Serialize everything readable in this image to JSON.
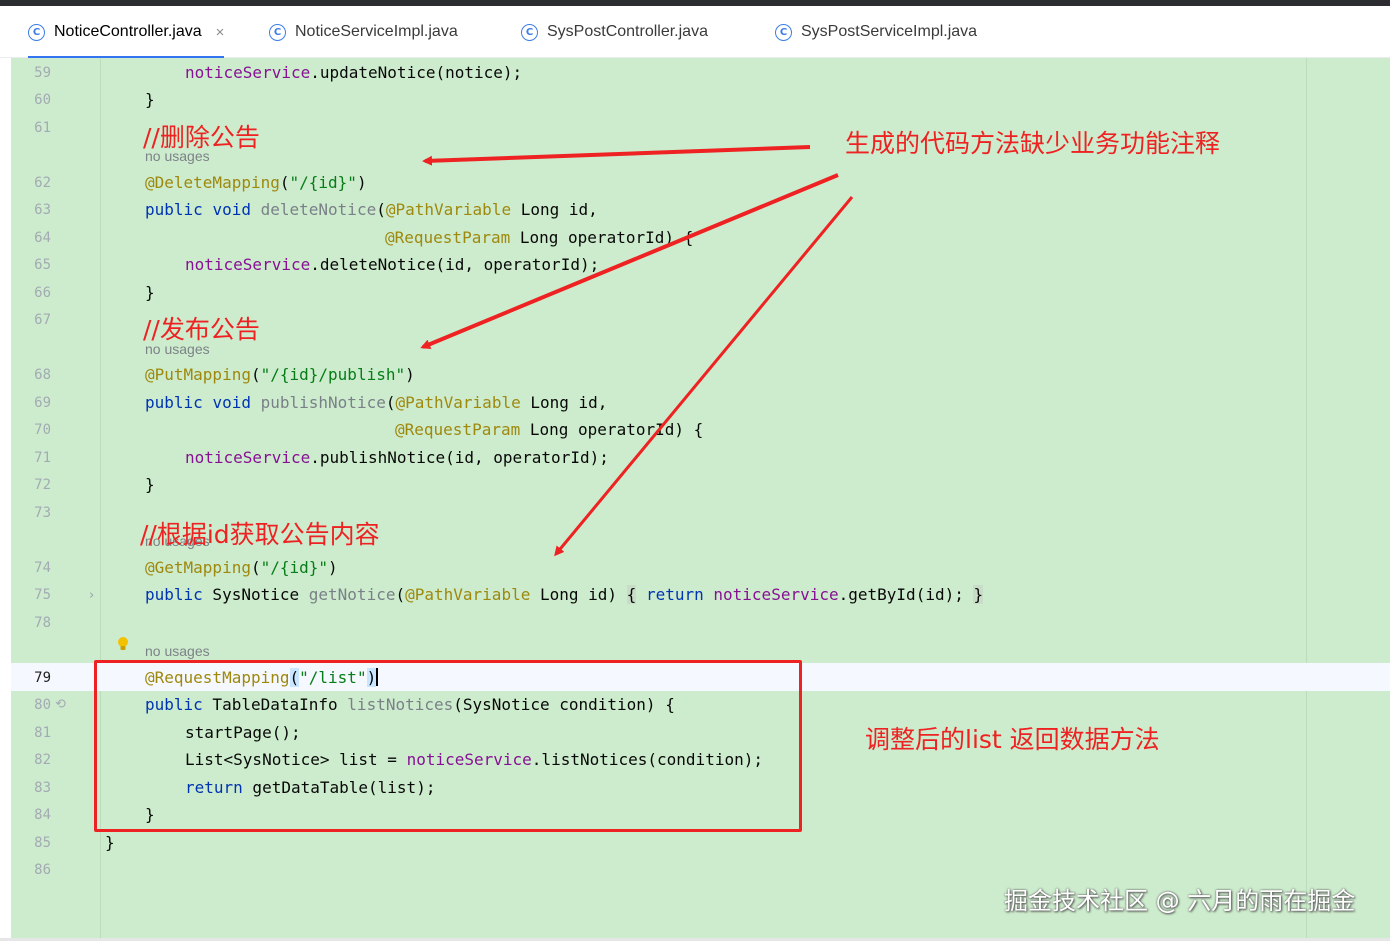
{
  "tabs": [
    {
      "label": "NoticeController.java",
      "active": true,
      "close": "×",
      "icon": "C"
    },
    {
      "label": "NoticeServiceImpl.java",
      "active": false,
      "icon": "C"
    },
    {
      "label": "SysPostController.java",
      "active": false,
      "icon": "C"
    },
    {
      "label": "SysPostServiceImpl.java",
      "active": false,
      "icon": "C"
    }
  ],
  "line_numbers": [
    "59",
    "60",
    "61",
    "62",
    "63",
    "64",
    "65",
    "66",
    "67",
    "68",
    "69",
    "70",
    "71",
    "72",
    "73",
    "74",
    "75",
    "78",
    "79",
    "80",
    "81",
    "82",
    "83",
    "84",
    "85",
    "86"
  ],
  "hints": {
    "no_usages": "no usages"
  },
  "code": {
    "l59_field": "noticeService",
    "l59_rest": ".updateNotice(notice);",
    "l60": "}",
    "l62_ann": "@DeleteMapping",
    "l62_open": "(",
    "l62_str": "\"/{id}\"",
    "l62_close": ")",
    "l63_kw1": "public",
    "l63_kw2": "void",
    "l63_name": "deleteNotice",
    "l63_open": "(",
    "l63_ann": "@PathVariable",
    "l63_rest": " Long id,",
    "l64_ann": "@RequestParam",
    "l64_rest": " Long operatorId) {",
    "l65_field": "noticeService",
    "l65_rest": ".deleteNotice(id, operatorId);",
    "l66": "}",
    "l68_ann": "@PutMapping",
    "l68_open": "(",
    "l68_str": "\"/{id}/publish\"",
    "l68_close": ")",
    "l69_kw1": "public",
    "l69_kw2": "void",
    "l69_name": "publishNotice",
    "l69_open": "(",
    "l69_ann": "@PathVariable",
    "l69_rest": " Long id,",
    "l70_ann": "@RequestParam",
    "l70_rest": " Long operatorId) {",
    "l71_field": "noticeService",
    "l71_rest": ".publishNotice(id, operatorId);",
    "l72": "}",
    "l74_ann": "@GetMapping",
    "l74_open": "(",
    "l74_str": "\"/{id}\"",
    "l74_close": ")",
    "l75_kw1": "public",
    "l75_type": " SysNotice ",
    "l75_name": "getNotice",
    "l75_open": "(",
    "l75_ann": "@PathVariable",
    "l75_rest": " Long id) ",
    "l75_brace1": "{",
    "l75_kw2": "return",
    "l75_field": "noticeService",
    "l75_call": ".getById(id); ",
    "l75_brace2": "}",
    "l79_ann": "@RequestMapping",
    "l79_open": "(",
    "l79_str": "\"/list\"",
    "l79_close": ")",
    "l80_kw1": "public",
    "l80_type": " TableDataInfo ",
    "l80_name": "listNotices",
    "l80_rest": "(SysNotice condition) {",
    "l81": "startPage();",
    "l82_pre": "List<SysNotice> list = ",
    "l82_field": "noticeService",
    "l82_rest": ".listNotices(condition);",
    "l83_kw": "return",
    "l83_rest": " getDataTable(list);",
    "l84": "}",
    "l85": "}"
  },
  "annotations": {
    "comment_delete": "//删除公告",
    "comment_publish": "//发布公告",
    "comment_get": "//根据id获取公告内容",
    "note_missing": "生成的代码方法缺少业务功能注释",
    "note_list": "调整后的list 返回数据方法"
  },
  "watermark": "掘金技术社区 @ 六月的雨在掘金",
  "colors": {
    "editor_bg": "#cdeccd",
    "annotation_red": "#ee2222",
    "keyword": "#0033b3",
    "annotation": "#9e880d",
    "string": "#067d17",
    "field": "#871094"
  }
}
